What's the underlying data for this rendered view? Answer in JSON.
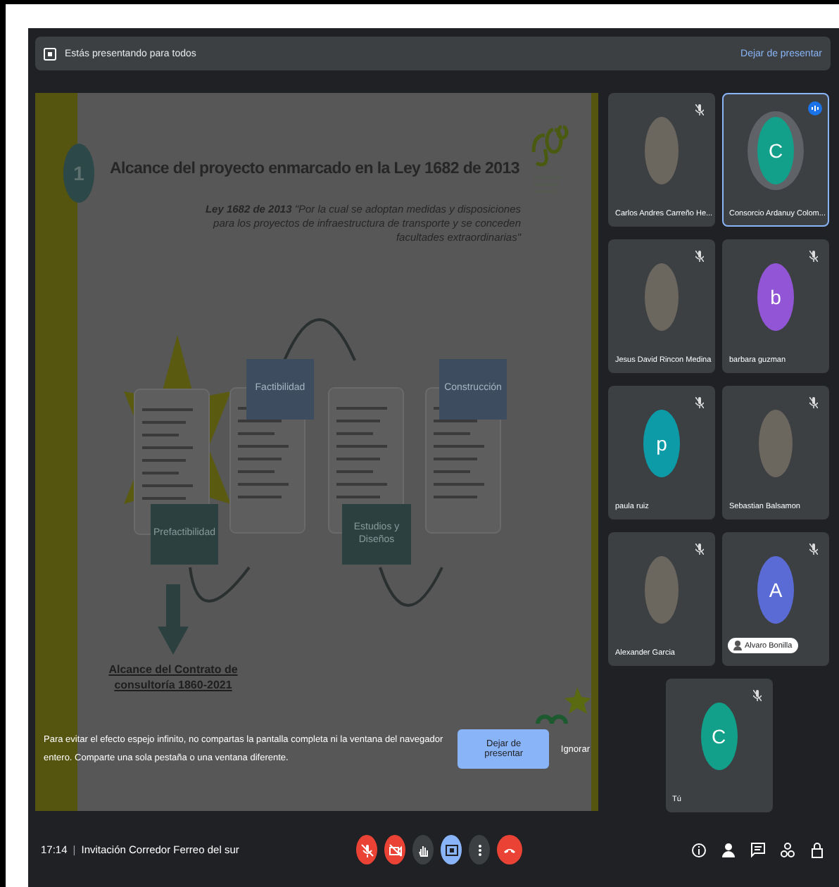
{
  "presenting_bar": {
    "text": "Estás presentando para todos",
    "action": "Dejar de presentar"
  },
  "slide": {
    "number": "1",
    "title": "Alcance del proyecto enmarcado en la Ley 1682 de 2013",
    "quote_lead": "Ley 1682 de 2013",
    "quote": "\"Por la cual se adoptan medidas y disposiciones para los proyectos de infraestructura de transporte y se conceden facultades extraordinarias\"",
    "stages": [
      {
        "label": "Prefactibilidad",
        "kind": "dark"
      },
      {
        "label": "Factibilidad",
        "kind": "blue"
      },
      {
        "label": "Estudios y Diseños",
        "kind": "dark"
      },
      {
        "label": "Construcción",
        "kind": "blue"
      }
    ],
    "scope": "Alcance del Contrato de consultoría 1860-2021"
  },
  "warning": {
    "text": "Para evitar el efecto espejo infinito, no compartas la pantalla completa ni la ventana del navegador entero. Comparte una sola pestaña o una ventana diferente.",
    "primary": "Dejar de presentar",
    "secondary": "Ignorar"
  },
  "participants": [
    {
      "name": "Carlos Andres Carreño He...",
      "kind": "photo",
      "selected": false,
      "muted": true,
      "name_chip": false
    },
    {
      "name": "Consorcio Ardanuy Colom...",
      "kind": "avatar",
      "letter": "C",
      "color": "#12a08a",
      "selected": true,
      "muted": false,
      "name_chip": false
    },
    {
      "name": "Jesus David Rincon Medina",
      "kind": "photo",
      "selected": false,
      "muted": true,
      "name_chip": false
    },
    {
      "name": "barbara guzman",
      "kind": "avatar",
      "letter": "b",
      "color": "#9155d6",
      "selected": false,
      "muted": true,
      "name_chip": false
    },
    {
      "name": "paula ruiz",
      "kind": "avatar",
      "letter": "p",
      "color": "#0d9ba8",
      "selected": false,
      "muted": true,
      "name_chip": false
    },
    {
      "name": "Sebastian Balsamon",
      "kind": "photo",
      "selected": false,
      "muted": true,
      "name_chip": false
    },
    {
      "name": "Alexander Garcia",
      "kind": "photo",
      "selected": false,
      "muted": true,
      "name_chip": false
    },
    {
      "name": "Alvaro Bonilla",
      "kind": "avatar",
      "letter": "A",
      "color": "#5b6bd6",
      "selected": false,
      "muted": true,
      "name_chip": true
    },
    {
      "name": "Tú",
      "kind": "avatar",
      "letter": "C",
      "color": "#12a08a",
      "selected": false,
      "muted": true,
      "name_chip": false
    }
  ],
  "bottom_bar": {
    "time": "17:14",
    "separator": "|",
    "meeting": "Invitación Corredor Ferreo del sur",
    "controls": [
      {
        "kind": "mic-off",
        "color": "#ea4335"
      },
      {
        "kind": "camera-off",
        "color": "#ea4335"
      },
      {
        "kind": "hand",
        "color": "#3c4043"
      },
      {
        "kind": "present",
        "color": "#8ab4f8"
      },
      {
        "kind": "more",
        "color": "#3c4043"
      },
      {
        "kind": "hangup",
        "color": "#ea4335"
      }
    ],
    "tools": [
      {
        "kind": "info"
      },
      {
        "kind": "people"
      },
      {
        "kind": "chat"
      },
      {
        "kind": "activities"
      },
      {
        "kind": "lock"
      }
    ]
  }
}
